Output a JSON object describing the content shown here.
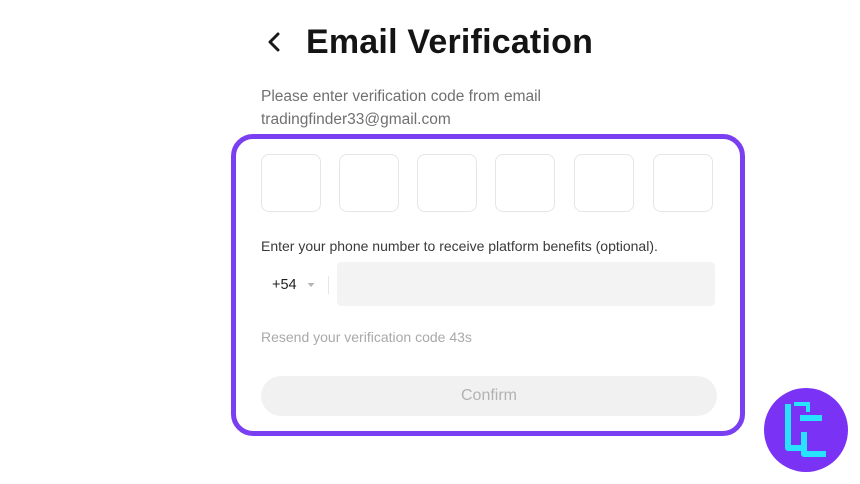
{
  "header": {
    "back_icon": "chevron-left-icon",
    "title": "Email Verification"
  },
  "subtitle": {
    "line1": "Please enter verification code from email",
    "email": "tradingfinder33@gmail.com"
  },
  "code_inputs": [
    "",
    "",
    "",
    "",
    "",
    ""
  ],
  "phone": {
    "label": "Enter your phone number to receive platform benefits (optional).",
    "country_code": "+54",
    "caret_icon": "caret-down-icon",
    "value": ""
  },
  "resend": {
    "text": "Resend your verification code 43s"
  },
  "confirm": {
    "label": "Confirm",
    "state": "disabled"
  },
  "colors": {
    "highlight": "#7b3ff2",
    "watermark_bg": "#7a33f5",
    "watermark_glyph": "#27e3ff"
  },
  "watermark": {
    "icon": "tradingfinder-logo-icon"
  }
}
